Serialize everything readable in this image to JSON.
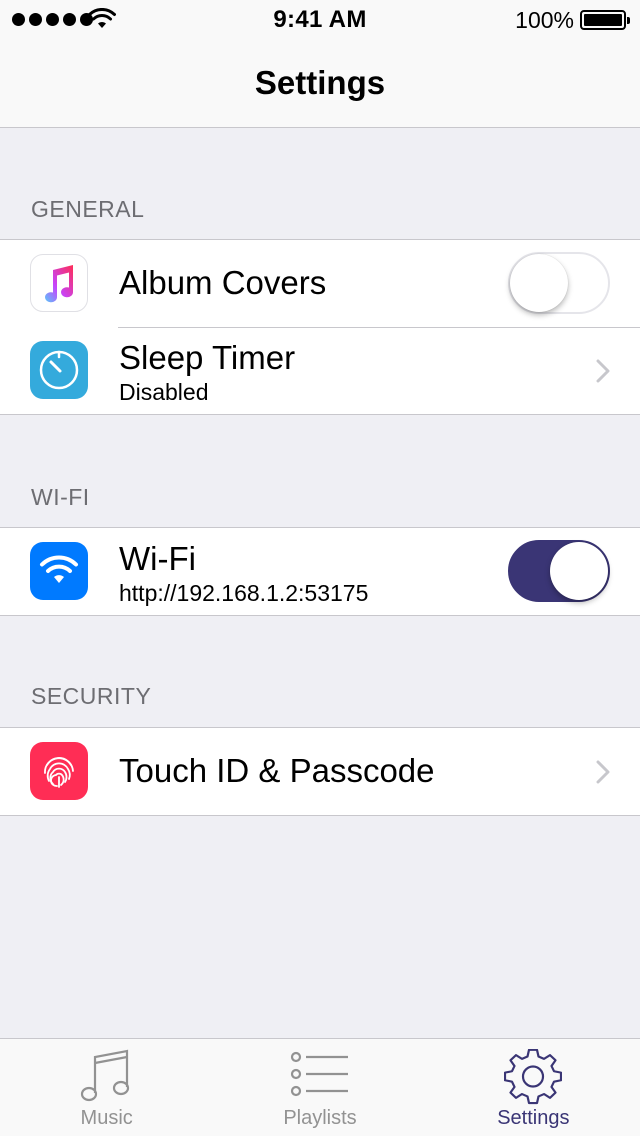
{
  "status_bar": {
    "time": "9:41 AM",
    "battery_percent": "100%",
    "signal_bars": 5,
    "signal_icon": "signal-dots-icon",
    "wifi_icon": "wifi-icon",
    "battery_icon": "battery-full-icon"
  },
  "nav": {
    "title": "Settings"
  },
  "sections": {
    "general": {
      "header": "GENERAL",
      "album_covers": {
        "title": "Album Covers",
        "icon": "music-note-icon",
        "toggle_on": false
      },
      "sleep_timer": {
        "title": "Sleep Timer",
        "subtitle": "Disabled",
        "icon": "timer-icon"
      }
    },
    "wifi": {
      "header": "WI-FI",
      "wifi": {
        "title": "Wi-Fi",
        "subtitle": "http://192.168.1.2:53175",
        "icon": "wifi-icon",
        "toggle_on": true
      }
    },
    "security": {
      "header": "SECURITY",
      "touch_id": {
        "title": "Touch ID & Passcode",
        "icon": "fingerprint-icon"
      }
    }
  },
  "tabbar": {
    "tabs": [
      {
        "label": "Music",
        "icon": "music-note-icon",
        "active": false
      },
      {
        "label": "Playlists",
        "icon": "list-icon",
        "active": false
      },
      {
        "label": "Settings",
        "icon": "gear-icon",
        "active": true
      }
    ]
  },
  "colors": {
    "accent": "#3a3575",
    "background": "#efeff4",
    "timer_icon_bg": "#34aadc",
    "wifi_icon_bg": "#007aff",
    "touchid_icon_bg": "#ff2d55",
    "inactive_tab": "#929292"
  }
}
